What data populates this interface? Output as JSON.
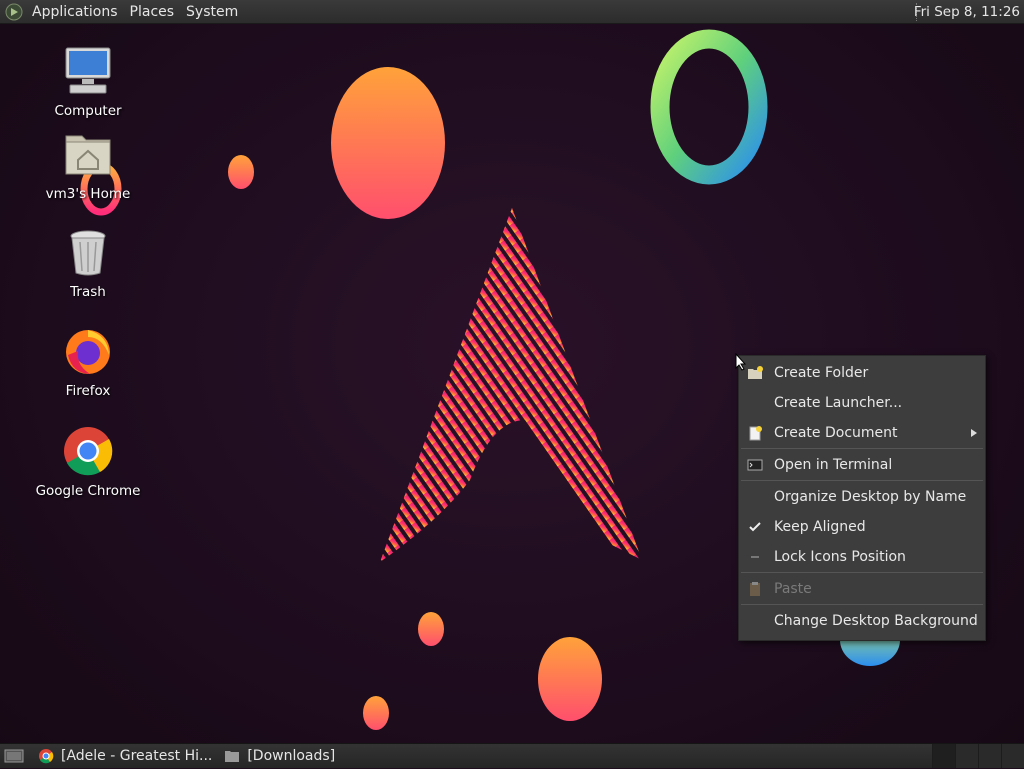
{
  "top_panel": {
    "menus": [
      "Applications",
      "Places",
      "System"
    ],
    "clock": "Fri Sep  8, 11:26"
  },
  "desktop_icons": [
    {
      "label": "Computer",
      "icon": "computer-icon"
    },
    {
      "label": "vm3's Home",
      "icon": "home-folder-icon"
    },
    {
      "label": "Trash",
      "icon": "trash-icon"
    },
    {
      "label": "Firefox",
      "icon": "firefox-icon"
    },
    {
      "label": "Google Chrome",
      "icon": "chrome-icon"
    }
  ],
  "context_menu": {
    "items": [
      {
        "label": "Create Folder",
        "icon": "new-folder-icon"
      },
      {
        "label": "Create Launcher...",
        "icon": ""
      },
      {
        "label": "Create Document",
        "icon": "new-document-icon",
        "submenu": true
      },
      {
        "label": "Open in Terminal",
        "icon": "terminal-icon"
      },
      {
        "label": "Organize Desktop by Name",
        "icon": ""
      },
      {
        "label": "Keep Aligned",
        "icon": "checkmark-icon",
        "checked": true
      },
      {
        "label": "Lock Icons Position",
        "icon": "unchecked-dash-icon",
        "checked": false
      },
      {
        "label": "Paste",
        "icon": "paste-icon",
        "disabled": true
      },
      {
        "label": "Change Desktop Background",
        "icon": ""
      }
    ]
  },
  "taskbar": {
    "tasks": [
      {
        "label": "[Adele - Greatest Hi...",
        "icon": "chrome-icon"
      },
      {
        "label": "[Downloads]",
        "icon": "folder-icon"
      }
    ]
  },
  "colors": {
    "accent_pink": "#e8336f",
    "accent_orange": "#ff9a3c",
    "panel_bg": "#2c2c2c",
    "menu_bg": "#3d3d3d"
  }
}
